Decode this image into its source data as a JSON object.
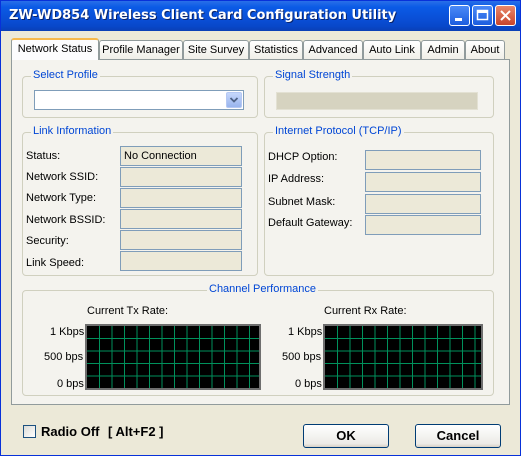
{
  "window": {
    "title": "ZW-WD854 Wireless Client Card Configuration Utility"
  },
  "tabs": [
    "Network Status",
    "Profile Manager",
    "Site Survey",
    "Statistics",
    "Advanced",
    "Auto Link",
    "Admin",
    "About"
  ],
  "select_profile": {
    "label": "Select Profile",
    "value": ""
  },
  "signal_strength": {
    "label": "Signal Strength",
    "level": 0
  },
  "link_info": {
    "label": "Link Information",
    "rows": [
      {
        "label": "Status:",
        "value": "No Connection"
      },
      {
        "label": "Network SSID:",
        "value": ""
      },
      {
        "label": "Network Type:",
        "value": ""
      },
      {
        "label": "Network BSSID:",
        "value": ""
      },
      {
        "label": "Security:",
        "value": ""
      },
      {
        "label": "Link Speed:",
        "value": ""
      }
    ]
  },
  "tcpip": {
    "label": "Internet Protocol (TCP/IP)",
    "rows": [
      {
        "label": "DHCP Option:",
        "value": ""
      },
      {
        "label": "IP Address:",
        "value": ""
      },
      {
        "label": "Subnet Mask:",
        "value": ""
      },
      {
        "label": "Default Gateway:",
        "value": ""
      }
    ]
  },
  "channel_performance": {
    "label": "Channel Performance",
    "tx": {
      "title": "Current Tx Rate:",
      "ticks": [
        "1 Kbps",
        "500 bps",
        "0 bps"
      ]
    },
    "rx": {
      "title": "Current Rx Rate:",
      "ticks": [
        "1 Kbps",
        "500 bps",
        "0 bps"
      ]
    }
  },
  "footer": {
    "radio_off": "Radio Off",
    "shortcut": "[ Alt+F2 ]",
    "ok": "OK",
    "cancel": "Cancel"
  },
  "colors": {
    "title_bar": "#0a4fd6",
    "group_label": "#0046d5",
    "graph_grid": "#00915c",
    "graph_bg": "#000000"
  }
}
